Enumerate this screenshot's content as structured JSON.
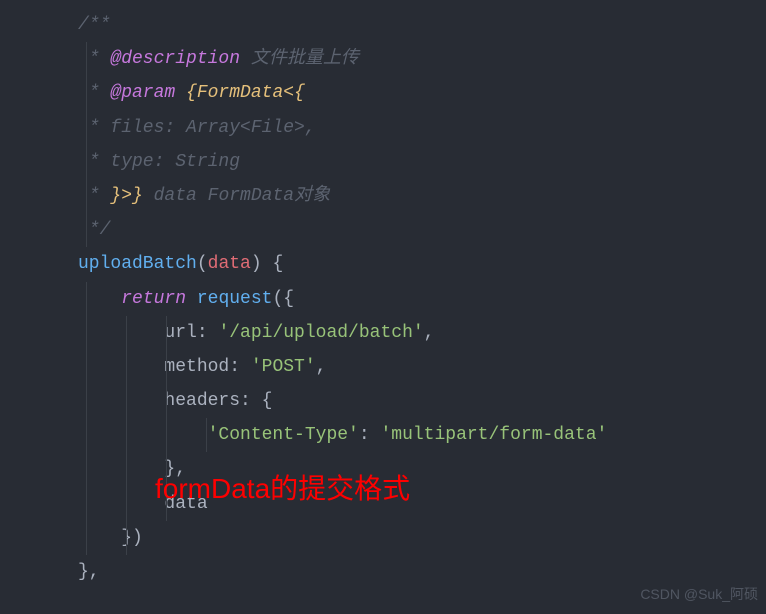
{
  "code": {
    "comment_open": "/**",
    "jsdoc_desc_tag": "@description",
    "jsdoc_desc_text": "文件批量上传",
    "jsdoc_param_tag": "@param",
    "jsdoc_param_type1": "{FormData<{",
    "jsdoc_files_line": "files: Array<File>,",
    "jsdoc_type_line": "type: String",
    "jsdoc_close_type": "}>}",
    "jsdoc_param_name": "data",
    "jsdoc_param_desc": "FormData对象",
    "comment_close": " */",
    "function_name": "uploadBatch",
    "function_param": "data",
    "return_kw": "return",
    "request_fn": "request",
    "url_key": "url",
    "url_value": "'/api/upload/batch'",
    "method_key": "method",
    "method_value": "'POST'",
    "headers_key": "headers",
    "content_type_key": "'Content-Type'",
    "content_type_value": "'multipart/form-data'",
    "data_shorthand": "data"
  },
  "annotation": "formData的提交格式",
  "watermark": "CSDN @Suk_阿硕"
}
